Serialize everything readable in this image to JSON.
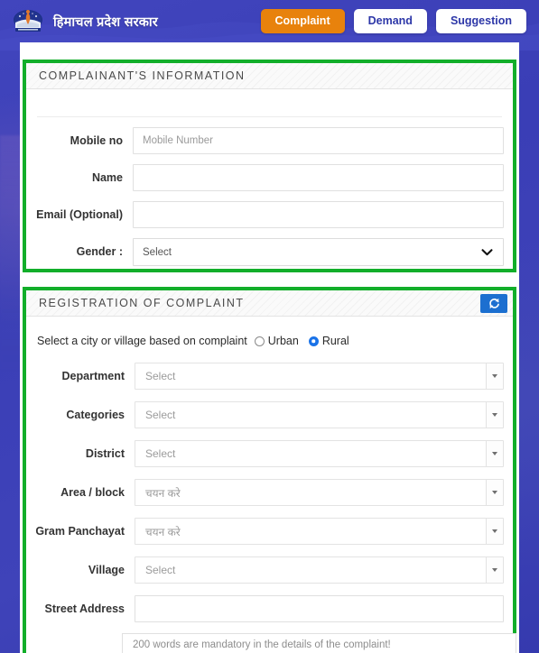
{
  "header": {
    "logo_alt": "Himachal Pradesh Government Emblem",
    "title": "हिमाचल प्रदेश सरकार",
    "nav": [
      {
        "label": "Complaint",
        "active": true
      },
      {
        "label": "Demand",
        "active": false
      },
      {
        "label": "Suggestion",
        "active": false
      }
    ]
  },
  "complainant_panel": {
    "title": "COMPLAINANT'S INFORMATION",
    "fields": {
      "mobile": {
        "label": "Mobile no",
        "value": "",
        "placeholder": "Mobile Number"
      },
      "name": {
        "label": "Name",
        "value": "",
        "placeholder": ""
      },
      "email": {
        "label": "Email (Optional)",
        "value": "",
        "placeholder": ""
      },
      "gender": {
        "label": "Gender :",
        "value": "Select"
      }
    }
  },
  "registration_panel": {
    "title": "REGISTRATION OF COMPLAINT",
    "refresh_icon": "refresh-icon",
    "area_question": "Select a city or village based on complaint",
    "area_options": [
      {
        "label": "Urban",
        "selected": false
      },
      {
        "label": "Rural",
        "selected": true
      }
    ],
    "fields": {
      "department": {
        "label": "Department",
        "value": "Select"
      },
      "categories": {
        "label": "Categories",
        "value": "Select"
      },
      "district": {
        "label": "District",
        "value": "Select"
      },
      "area_block": {
        "label": "Area / block",
        "value": "चयन करे"
      },
      "gram_panchayat": {
        "label": "Gram Panchayat",
        "value": "चयन करे"
      },
      "village": {
        "label": "Village",
        "value": "Select"
      },
      "street_address": {
        "label": "Street Address",
        "value": "",
        "placeholder": ""
      }
    }
  },
  "note": {
    "text": "200 words are mandatory in the details of the complaint!"
  },
  "colors": {
    "panel_border_green": "#12ae2a",
    "nav_active_orange": "#e8820c",
    "refresh_blue": "#1c6fd0",
    "radio_blue": "#1a73e8",
    "page_blue": "#3b3fb5"
  }
}
